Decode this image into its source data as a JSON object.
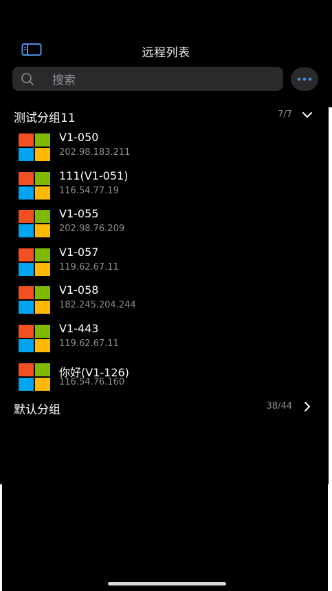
{
  "header": {
    "title": "远程列表",
    "sidebar_icon": "sidebar-toggle-icon",
    "more_icon": "ellipsis-icon"
  },
  "search": {
    "placeholder": "搜索"
  },
  "colors": {
    "accent": "#4a90e2",
    "win_red": "#f25022",
    "win_green": "#7fba00",
    "win_blue": "#00a4ef",
    "win_yellow": "#ffb900"
  },
  "groups": [
    {
      "name": "测试分组11",
      "count": "7/7",
      "expanded": true,
      "hosts": [
        {
          "name": "V1-050",
          "ip": "202.98.183.211"
        },
        {
          "name": "111(V1-051)",
          "ip": "116.54.77.19"
        },
        {
          "name": "V1-055",
          "ip": "202.98.76.209"
        },
        {
          "name": "V1-057",
          "ip": "119.62.67.11"
        },
        {
          "name": "V1-058",
          "ip": "182.245.204.244"
        },
        {
          "name": "V1-443",
          "ip": "119.62.67.11"
        },
        {
          "name": "你好(V1-126)",
          "ip": "116.54.76.160"
        }
      ]
    },
    {
      "name": "默认分组",
      "count": "38/44",
      "expanded": false
    }
  ]
}
